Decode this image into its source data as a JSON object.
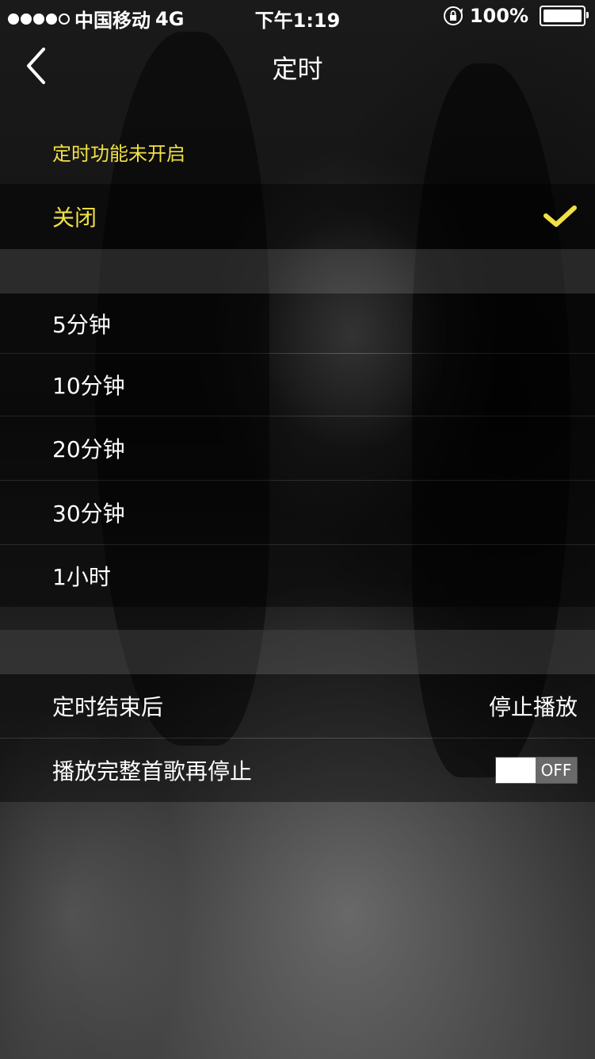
{
  "status_bar": {
    "carrier": "中国移动",
    "network": "4G",
    "time": "下午1:19",
    "battery_percent": "100%",
    "battery_level": 1.0,
    "signal_bars_filled": 4,
    "signal_bars_total": 5
  },
  "nav": {
    "title": "定时",
    "back_icon": "chevron-left-icon"
  },
  "timer": {
    "status_label": "定时功能未开启",
    "off_option": {
      "label": "关闭",
      "selected": true
    },
    "options": [
      {
        "label": "5分钟"
      },
      {
        "label": "10分钟"
      },
      {
        "label": "20分钟"
      },
      {
        "label": "30分钟"
      },
      {
        "label": "1小时"
      }
    ]
  },
  "after_timer": {
    "label": "定时结束后",
    "value": "停止播放"
  },
  "finish_song": {
    "label": "播放完整首歌再停止",
    "toggle_state": "OFF",
    "enabled": false
  },
  "colors": {
    "accent": "#f0e044",
    "text": "#ffffff"
  }
}
